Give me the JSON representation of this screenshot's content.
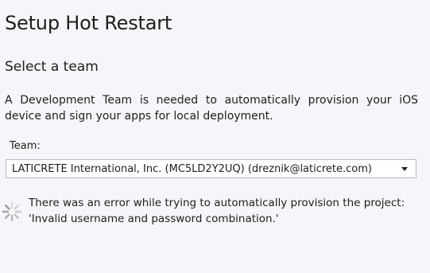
{
  "header": {
    "title": "Setup Hot Restart"
  },
  "section": {
    "title": "Select a team",
    "description": "A Development Team is needed to automatically provision your iOS device and sign your apps for local deployment."
  },
  "team": {
    "label": "Team:",
    "selected_value": "LATICRETE International, Inc. (MC5LD2Y2UQ) (dreznik@laticrete.com)",
    "dropdown_icon": "chevron-down-icon"
  },
  "status": {
    "icon": "spinner-icon",
    "error_line1": "There was an error while trying to automatically provision the project:",
    "error_line2": "'Invalid username and password combination.'"
  },
  "colors": {
    "background": "#f6f5f9",
    "text": "#1e1e1e",
    "select_border": "#b9b9c1",
    "spinner": "#9a9a9a"
  }
}
